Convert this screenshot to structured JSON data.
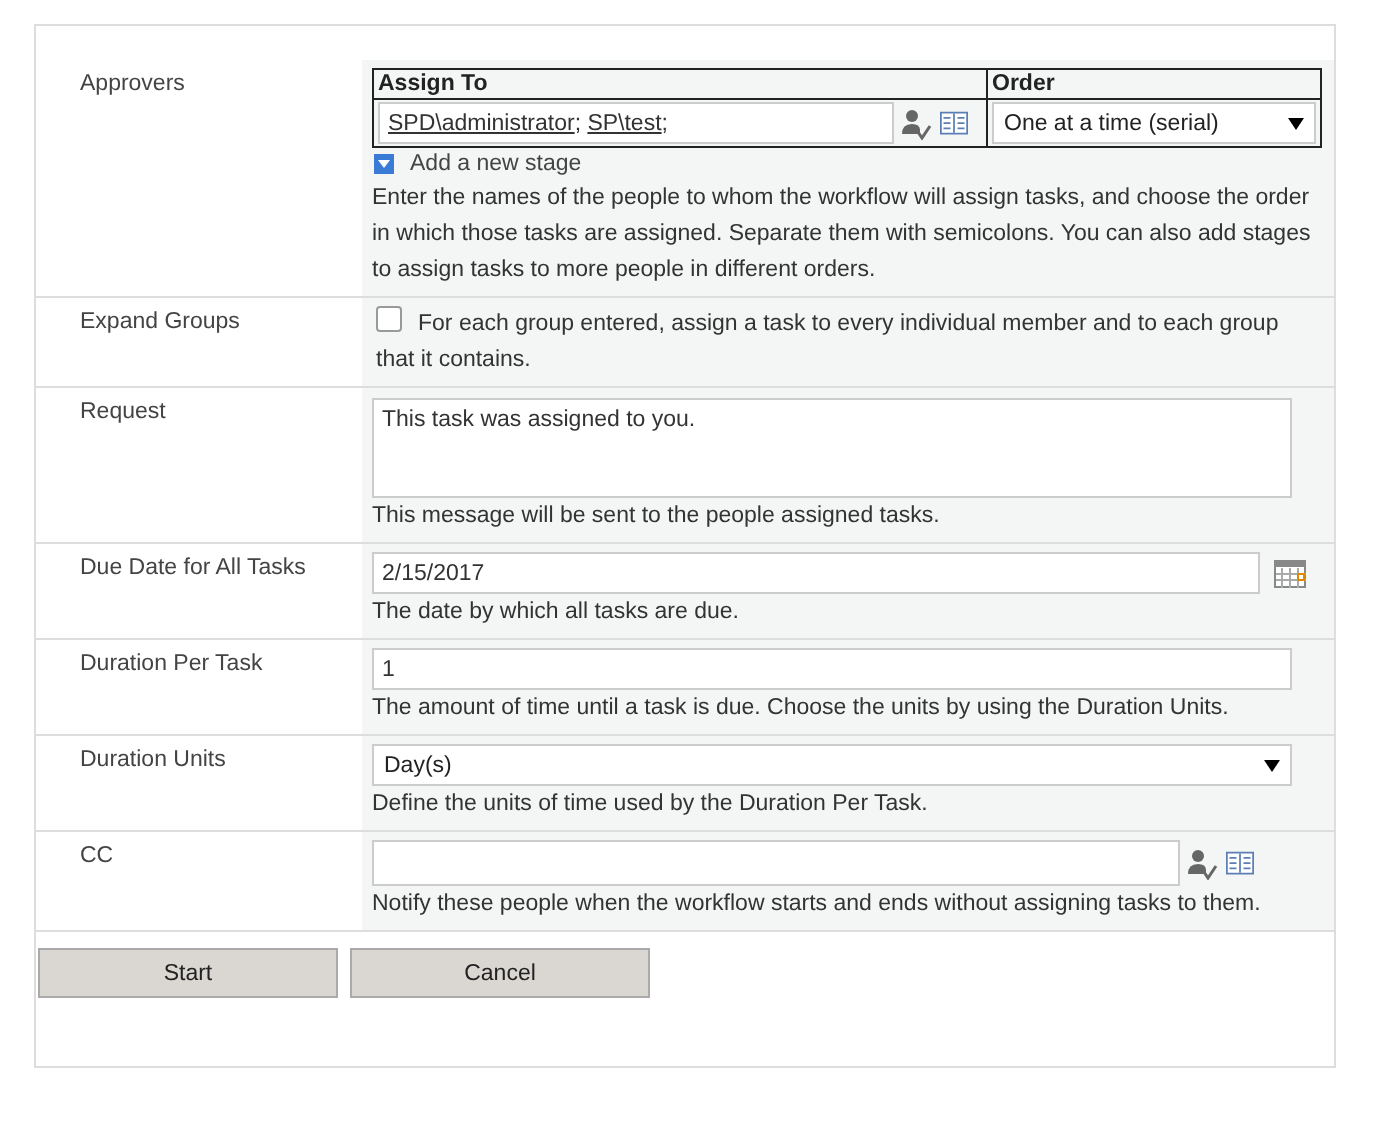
{
  "rows": [
    {
      "kind": "approvers",
      "label": "Approvers",
      "columns": [
        "Assign To",
        "Order"
      ],
      "people": [
        {
          "name": "SPD\\administrator",
          "sep": ";"
        },
        {
          "name": "SP\\test",
          "sep": ";"
        }
      ],
      "order": "One at a time (serial)",
      "add_stage": "Add a new stage",
      "help": "Enter the names of the people to whom the workflow will assign tasks, and choose the order in which those tasks are assigned. Separate them with semicolons. You can also add stages to assign tasks to more people in different orders."
    },
    {
      "kind": "checkbox",
      "label": "Expand Groups",
      "checked": false,
      "help": "For each group entered, assign a task to every individual member and to each group that it contains."
    },
    {
      "kind": "textarea",
      "label": "Request",
      "value": "This task was assigned to you.",
      "help": "This message will be sent to the people assigned tasks."
    },
    {
      "kind": "date",
      "label": "Due Date for All Tasks",
      "value": "2/15/2017",
      "help": "The date by which all tasks are due."
    },
    {
      "kind": "text",
      "label": "Duration Per Task",
      "value": "1",
      "help": "The amount of time until a task is due. Choose the units by using the Duration Units."
    },
    {
      "kind": "select",
      "label": "Duration Units",
      "value": "Day(s)",
      "help": "Define the units of time used by the Duration Per Task."
    },
    {
      "kind": "people",
      "label": "CC",
      "value": "",
      "help": "Notify these people when the workflow starts and ends without assigning tasks to them."
    }
  ],
  "buttons": [
    "Start",
    "Cancel"
  ]
}
